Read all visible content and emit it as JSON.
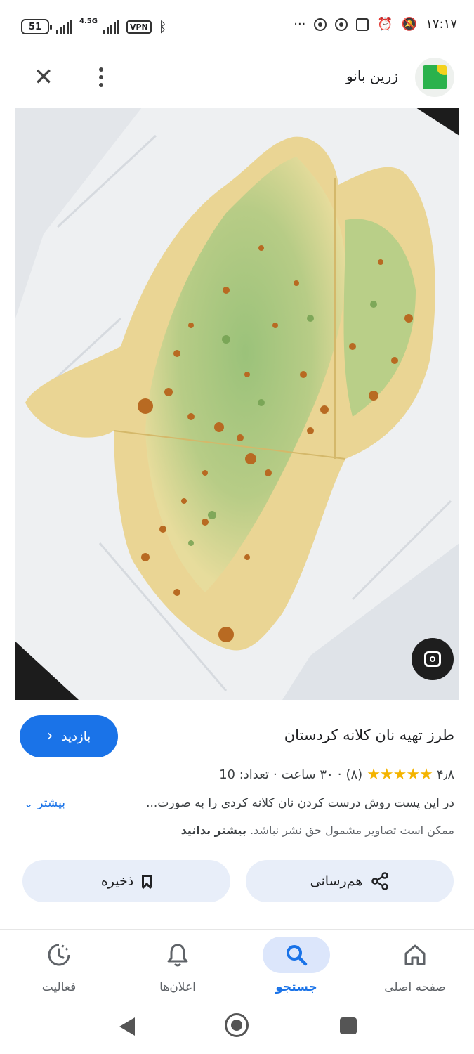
{
  "status_bar": {
    "battery": "51",
    "network": "4.5G",
    "vpn": "VPN",
    "more": "···",
    "time": "۱۷:۱۷"
  },
  "header": {
    "site_name": "زرین بانو",
    "close_icon": "close-icon",
    "menu_icon": "more-vertical-icon",
    "logo_icon": "site-logo"
  },
  "image": {
    "subject": "kurdish-kalaneh-flatbread",
    "lens_icon": "google-lens-icon"
  },
  "result": {
    "visit_label": "بازدید",
    "title": "طرز تهیه نان کلانه کردستان",
    "rating": "۴٫۸",
    "stars": "★★★★★",
    "reviews": "(۸)",
    "time_text": "۳۰ ساعت",
    "count_text": "تعداد: 10",
    "separator": "·",
    "description": "در این پست روش درست کردن نان کلانه کردی را به صورت...",
    "more_label": "بیشتر",
    "copyright_text": "ممکن است تصاویر مشمول حق نشر نباشد.",
    "learn_more": "بیشتر بدانید"
  },
  "actions": {
    "save_label": "ذخیره",
    "share_label": "هم‌رسانی"
  },
  "bottom_nav": {
    "home": "صفحه اصلی",
    "search": "جستجو",
    "notifications": "اعلان‌ها",
    "activity": "فعالیت"
  },
  "colors": {
    "accent": "#1a73e8",
    "star": "#f4b400",
    "chip_bg": "#e8eef9"
  }
}
